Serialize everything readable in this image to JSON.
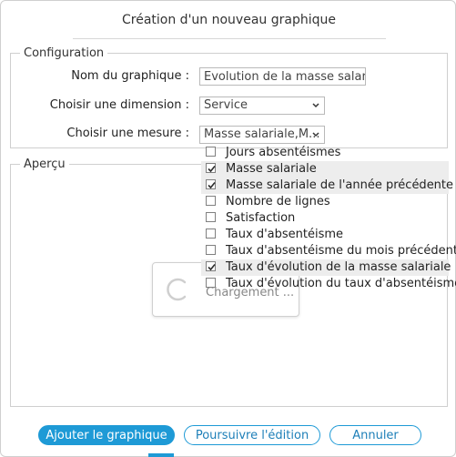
{
  "dialog": {
    "title": "Création d'un nouveau graphique"
  },
  "configuration": {
    "legend": "Configuration",
    "name_label": "Nom du graphique :",
    "name_value": "Evolution de la masse salaria",
    "dimension_label": "Choisir une dimension :",
    "dimension_value": "Service",
    "measure_label": "Choisir une mesure :",
    "measure_value": "Masse salariale,M..."
  },
  "measure_options": [
    {
      "label": "Jours absentéismes",
      "checked": false
    },
    {
      "label": "Masse salariale",
      "checked": true
    },
    {
      "label": "Masse salariale de l'année précédente",
      "checked": true
    },
    {
      "label": "Nombre de lignes",
      "checked": false
    },
    {
      "label": "Satisfaction",
      "checked": false
    },
    {
      "label": "Taux d'absentéisme",
      "checked": false
    },
    {
      "label": "Taux d'absentéisme du mois précédent",
      "checked": false
    },
    {
      "label": "Taux d'évolution de la masse salariale",
      "checked": true
    },
    {
      "label": "Taux d'évolution du taux d'absentéisme",
      "checked": false
    }
  ],
  "apercu": {
    "legend": "Aperçu",
    "loading_text": "Chargement ..."
  },
  "buttons": {
    "add": "Ajouter le graphique",
    "continue": "Poursuivre l'édition",
    "cancel": "Annuler"
  },
  "colors": {
    "accent": "#1e9ad6",
    "checked_row": "#ededed"
  },
  "icons": {
    "select_arrow": "chevron-down-icon",
    "spinner": "loading-spinner-icon",
    "checkbox_check": "check-icon"
  }
}
